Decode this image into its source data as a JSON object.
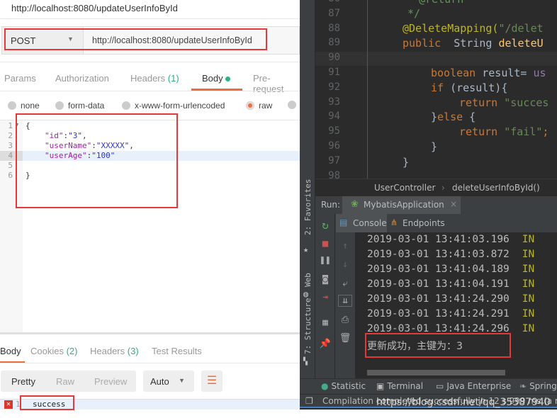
{
  "postman": {
    "title": "http://localhost:8080/updateUserInfoById",
    "method": "POST",
    "url": "http://localhost:8080/updateUserInfoById",
    "request_tabs": [
      {
        "label": "Params"
      },
      {
        "label": "Authorization"
      },
      {
        "label": "Headers",
        "count": "(1)"
      },
      {
        "label": "Body"
      },
      {
        "label": "Pre-request"
      }
    ],
    "body_types": [
      "none",
      "form-data",
      "x-www-form-urlencoded",
      "raw"
    ],
    "selected_body_type": "raw",
    "body_lines": [
      {
        "n": "1",
        "text": "{"
      },
      {
        "n": "2",
        "key": "\"id\"",
        "value": "\"3\"",
        "end": ","
      },
      {
        "n": "3",
        "key": "\"userName\"",
        "value": "\"XXXXX\"",
        "end": ","
      },
      {
        "n": "4",
        "key": "\"userAge\"",
        "value": "\"100\"",
        "end": ""
      },
      {
        "n": "5",
        "text": ""
      },
      {
        "n": "6",
        "text": "}"
      }
    ],
    "response_tabs": [
      {
        "label": "Body"
      },
      {
        "label": "Cookies",
        "count": "(2)"
      },
      {
        "label": "Headers",
        "count": "(3)"
      },
      {
        "label": "Test Results"
      }
    ],
    "view_modes": [
      "Pretty",
      "Raw",
      "Preview"
    ],
    "format": "Auto",
    "response_line": {
      "n": "1",
      "text": "success"
    },
    "accent": "#f26b3a"
  },
  "ide": {
    "code_lines": [
      {
        "n": "86"
      },
      {
        "n": "87"
      },
      {
        "n": "88"
      },
      {
        "n": "89"
      },
      {
        "n": "90"
      },
      {
        "n": "91"
      },
      {
        "n": "92"
      },
      {
        "n": "93"
      },
      {
        "n": "94"
      },
      {
        "n": "95"
      },
      {
        "n": "96"
      },
      {
        "n": "97"
      },
      {
        "n": "98"
      }
    ],
    "code": {
      "l86": "* @return",
      "l87": "*/",
      "l88a": "@DeleteMapping(",
      "l88b": "\"/delet",
      "l89a": "public",
      "l89b": "  String ",
      "l89c": "deleteU",
      "l91a": "boolean",
      "l91b": " result= ",
      "l91c": "us",
      "l92a": "if",
      "l92b": " (result){",
      "l93a": "return",
      "l93b": " \"succes",
      "l94a": "}",
      "l94b": "else",
      " l94c": " {",
      "l95a": "return",
      "l95b": " \"fail\"",
      "l95c": ";",
      "l96": "}",
      "l97": "}"
    },
    "breadcrumb": [
      "UserController",
      "deleteUserInfoById()"
    ],
    "run_label": "Run:",
    "run_tab": "MybatisApplication",
    "side_tools": [
      "2: Favorites",
      "Web",
      "7: Structure"
    ],
    "console_tabs": [
      "Console",
      "Endpoints"
    ],
    "console_lines": [
      {
        "time": "2019-03-01 13:41:03.196",
        "level": "IN"
      },
      {
        "time": "2019-03-01 13:41:03.872",
        "level": "IN"
      },
      {
        "time": "2019-03-01 13:41:04.189",
        "level": "IN"
      },
      {
        "time": "2019-03-01 13:41:04.191",
        "level": "IN"
      },
      {
        "time": "2019-03-01 13:41:24.290",
        "level": "IN"
      },
      {
        "time": "2019-03-01 13:41:24.291",
        "level": "IN"
      },
      {
        "time": "2019-03-01 13:41:24.296",
        "level": "IN"
      }
    ],
    "console_message": "更新成功，主键为：3",
    "bottom_tabs": [
      "Statistic",
      "Terminal",
      "Java Enterprise",
      "Spring"
    ],
    "status": "Compilation completed successfully in 12 s 999 ms (a min",
    "watermark": "https://blog.csdn.net/qq_35387940"
  }
}
